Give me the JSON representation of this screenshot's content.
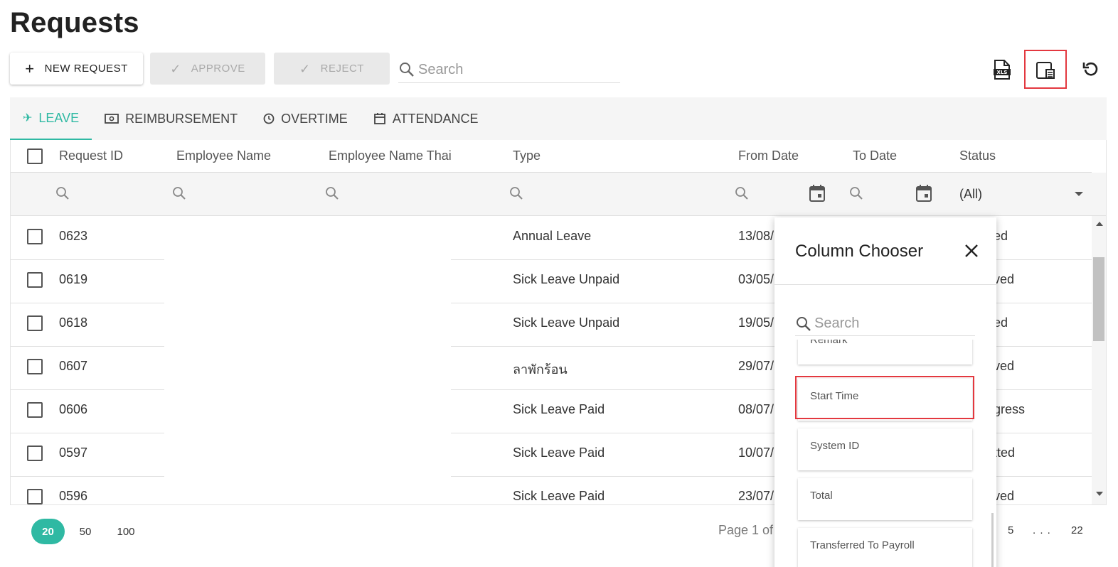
{
  "page": {
    "title": "Requests"
  },
  "toolbar": {
    "new_request_label": "NEW REQUEST",
    "approve_label": "APPROVE",
    "reject_label": "REJECT",
    "search_placeholder": "Search"
  },
  "tabs": [
    {
      "label": "LEAVE",
      "icon": "airplane-icon",
      "active": true
    },
    {
      "label": "REIMBURSEMENT",
      "icon": "money-icon",
      "active": false
    },
    {
      "label": "OVERTIME",
      "icon": "clock-icon",
      "active": false
    },
    {
      "label": "ATTENDANCE",
      "icon": "calendar-icon",
      "active": false
    }
  ],
  "grid": {
    "columns": [
      "Request ID",
      "Employee Name",
      "Employee Name Thai",
      "Type",
      "From Date",
      "To Date",
      "Status"
    ],
    "status_filter": "(All)",
    "rows": [
      {
        "id": "0623",
        "type": "Annual Leave",
        "from": "13/08/",
        "status": "ed"
      },
      {
        "id": "0619",
        "type": "Sick Leave Unpaid",
        "from": "03/05/",
        "status": "ved"
      },
      {
        "id": "0618",
        "type": "Sick Leave Unpaid",
        "from": "19/05/",
        "status": "ed"
      },
      {
        "id": "0607",
        "type": "ลาพักร้อน",
        "from": "29/07/",
        "status": "ved"
      },
      {
        "id": "0606",
        "type": "Sick Leave Paid",
        "from": "08/07/",
        "status": "gress"
      },
      {
        "id": "0597",
        "type": "Sick Leave Paid",
        "from": "10/07/",
        "status": "tted"
      },
      {
        "id": "0596",
        "type": "Sick Leave Paid",
        "from": "23/07/",
        "status": "ved"
      }
    ]
  },
  "pager": {
    "sizes": [
      "20",
      "50",
      "100"
    ],
    "active_size": "20",
    "info": "Page 1 of",
    "pages": [
      "5",
      ". . .",
      "22"
    ]
  },
  "column_chooser": {
    "title": "Column Chooser",
    "search_placeholder": "Search",
    "items": [
      "Remark",
      "Start Time",
      "System ID",
      "Total",
      "Transferred To Payroll"
    ]
  },
  "colors": {
    "accent": "#2fb9a3",
    "highlight": "#e3383f"
  }
}
